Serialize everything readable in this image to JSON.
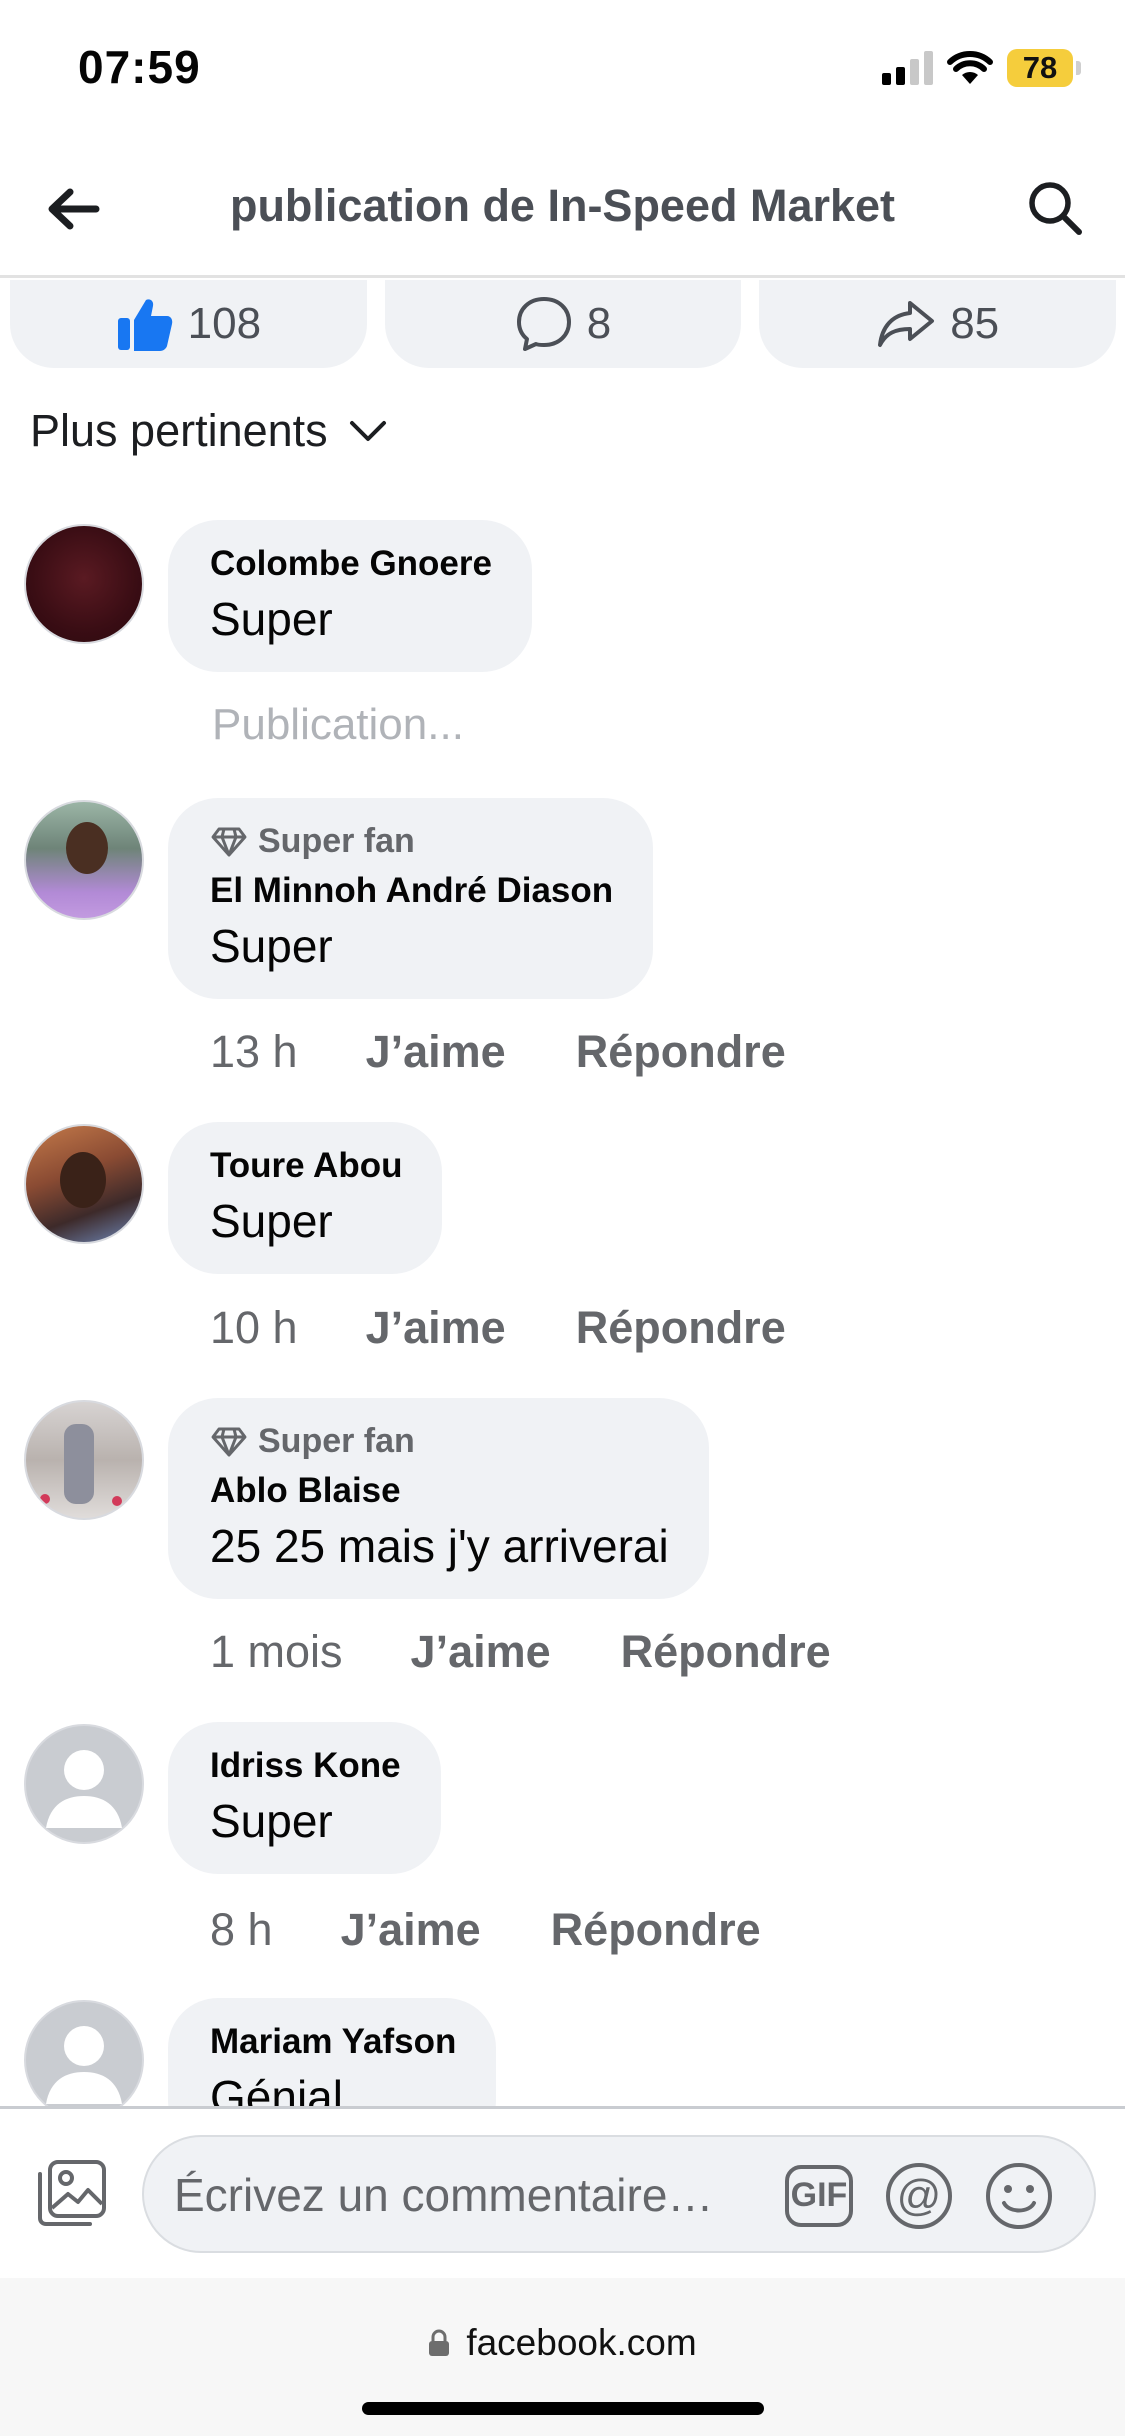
{
  "status_bar": {
    "time": "07:59",
    "battery": "78"
  },
  "header": {
    "title": "publication de In-Speed Market",
    "back_icon": "arrow-left-icon",
    "search_icon": "search-icon"
  },
  "actions": {
    "likes": "108",
    "comments": "8",
    "shares": "85"
  },
  "sort": {
    "label": "Plus pertinents"
  },
  "comments": [
    {
      "name": "Colombe Gnoere",
      "text": "Super",
      "status": "Publication..."
    },
    {
      "badge": "Super fan",
      "name": "El Minnoh André Diason",
      "text": "Super",
      "time": "13 h",
      "like": "J’aime",
      "reply": "Répondre"
    },
    {
      "name": "Toure Abou",
      "text": "Super",
      "time": "10 h",
      "like": "J’aime",
      "reply": "Répondre"
    },
    {
      "badge": "Super fan",
      "name": "Ablo Blaise",
      "text": "25 25 mais j'y arriverai",
      "time": "1 mois",
      "like": "J’aime",
      "reply": "Répondre"
    },
    {
      "name": "Idriss Kone",
      "text": "Super",
      "time": "8 h",
      "like": "J’aime",
      "reply": "Répondre"
    },
    {
      "name": "Mariam Yafson",
      "text": "Génial"
    }
  ],
  "composer": {
    "placeholder": "Écrivez un commentaire…",
    "gif_label": "GIF",
    "mention_label": "@"
  },
  "browser": {
    "url": "facebook.com"
  },
  "colors": {
    "like_blue": "#1877f2",
    "bubble_bg": "#f0f2f5",
    "battery_yellow": "#f5cd3c"
  }
}
